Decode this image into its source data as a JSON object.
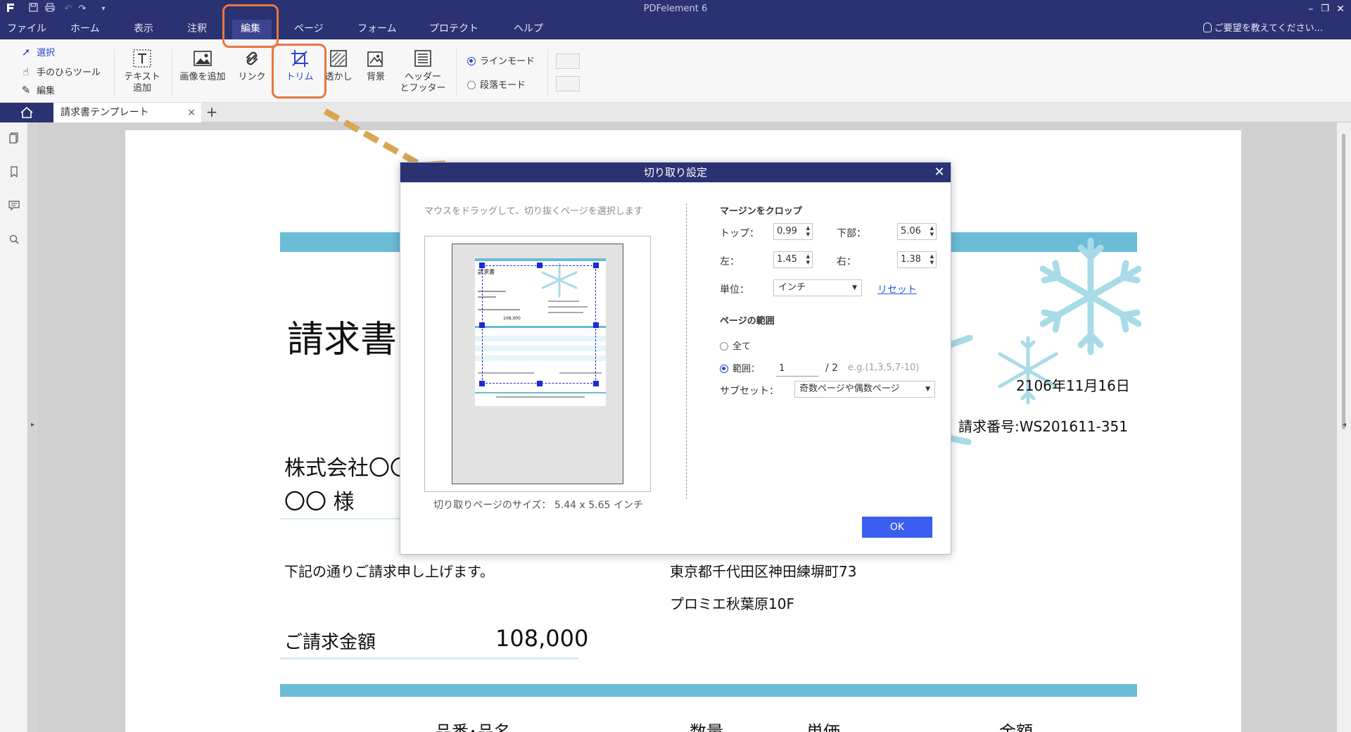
{
  "app": {
    "title": "PDFelement 6",
    "help_hint": "ご要望を教えてください..."
  },
  "menu": {
    "items": [
      "ファイル",
      "ホーム",
      "表示",
      "注釈",
      "編集",
      "ページ",
      "フォーム",
      "プロテクト",
      "ヘルプ"
    ],
    "active": "編集"
  },
  "ribbon": {
    "select": "選択",
    "hand": "手のひらツール",
    "edit": "編集",
    "add_text_line1": "テキスト",
    "add_text_line2": "追加",
    "add_image": "画像を追加",
    "link": "リンク",
    "trim": "トリム",
    "watermark": "透かし",
    "background": "背景",
    "header_footer_line1": "ヘッダー",
    "header_footer_line2": "とフッター",
    "line_mode": "ラインモード",
    "paragraph_mode": "段落モード"
  },
  "tabs": {
    "document": "請求書テンプレート",
    "close": "×",
    "new": "+"
  },
  "document": {
    "title": "請求書",
    "date": "2106年11月16日",
    "invoice_no": "請求番号:WS201611-351",
    "company": "株式会社〇〇",
    "recipient": "〇〇 様",
    "intro": "下記の通りご請求申し上げます。",
    "address1": "東京都千代田区神田練塀町73",
    "address2": "プロミエ秋葉原10F",
    "amount_label": "ご請求金額",
    "amount": "108,000",
    "col_item": "品番･品名",
    "col_qty": "数量",
    "col_price": "単価",
    "col_total": "金額"
  },
  "dialog": {
    "title": "切り取り設定",
    "hint": "マウスをドラッグして、切り抜くページを選択します",
    "crop_size_label": "切り取りページのサイズ：",
    "crop_size_value": "5.44 x 5.65 インチ",
    "margin_title": "マージンをクロップ",
    "top_label": "トップ：",
    "top_value": "0.99",
    "bottom_label": "下部：",
    "bottom_value": "5.06",
    "left_label": "左：",
    "left_value": "1.45",
    "right_label": "右：",
    "right_value": "1.38",
    "unit_label": "単位：",
    "unit_value": "インチ",
    "reset": "リセット",
    "range_title": "ページの範囲",
    "all": "全て",
    "range_label": "範囲：",
    "range_value": "1",
    "range_total": "/  2",
    "range_hint": "e.g.(1,3,5,7-10)",
    "subset_label": "サブセット：",
    "subset_value": "奇数ページや偶数ページ",
    "ok": "OK",
    "range_all_selected": false,
    "range_custom_selected": true
  },
  "mini_preview": {
    "title": "請求書",
    "amount": "108,000"
  },
  "colors": {
    "titlebar": "#2b3272",
    "band": "#6bbcd6",
    "accent": "#2d44c9",
    "annotation": "#e8773c",
    "ok_button": "#3a5ef0"
  },
  "icons": {
    "logo": "pdfelement-logo-icon",
    "save": "save-icon",
    "print": "print-icon",
    "undo": "undo-icon",
    "redo": "redo-icon",
    "home": "home-icon",
    "crop": "crop-icon",
    "snowflake": "snowflake-icon"
  }
}
